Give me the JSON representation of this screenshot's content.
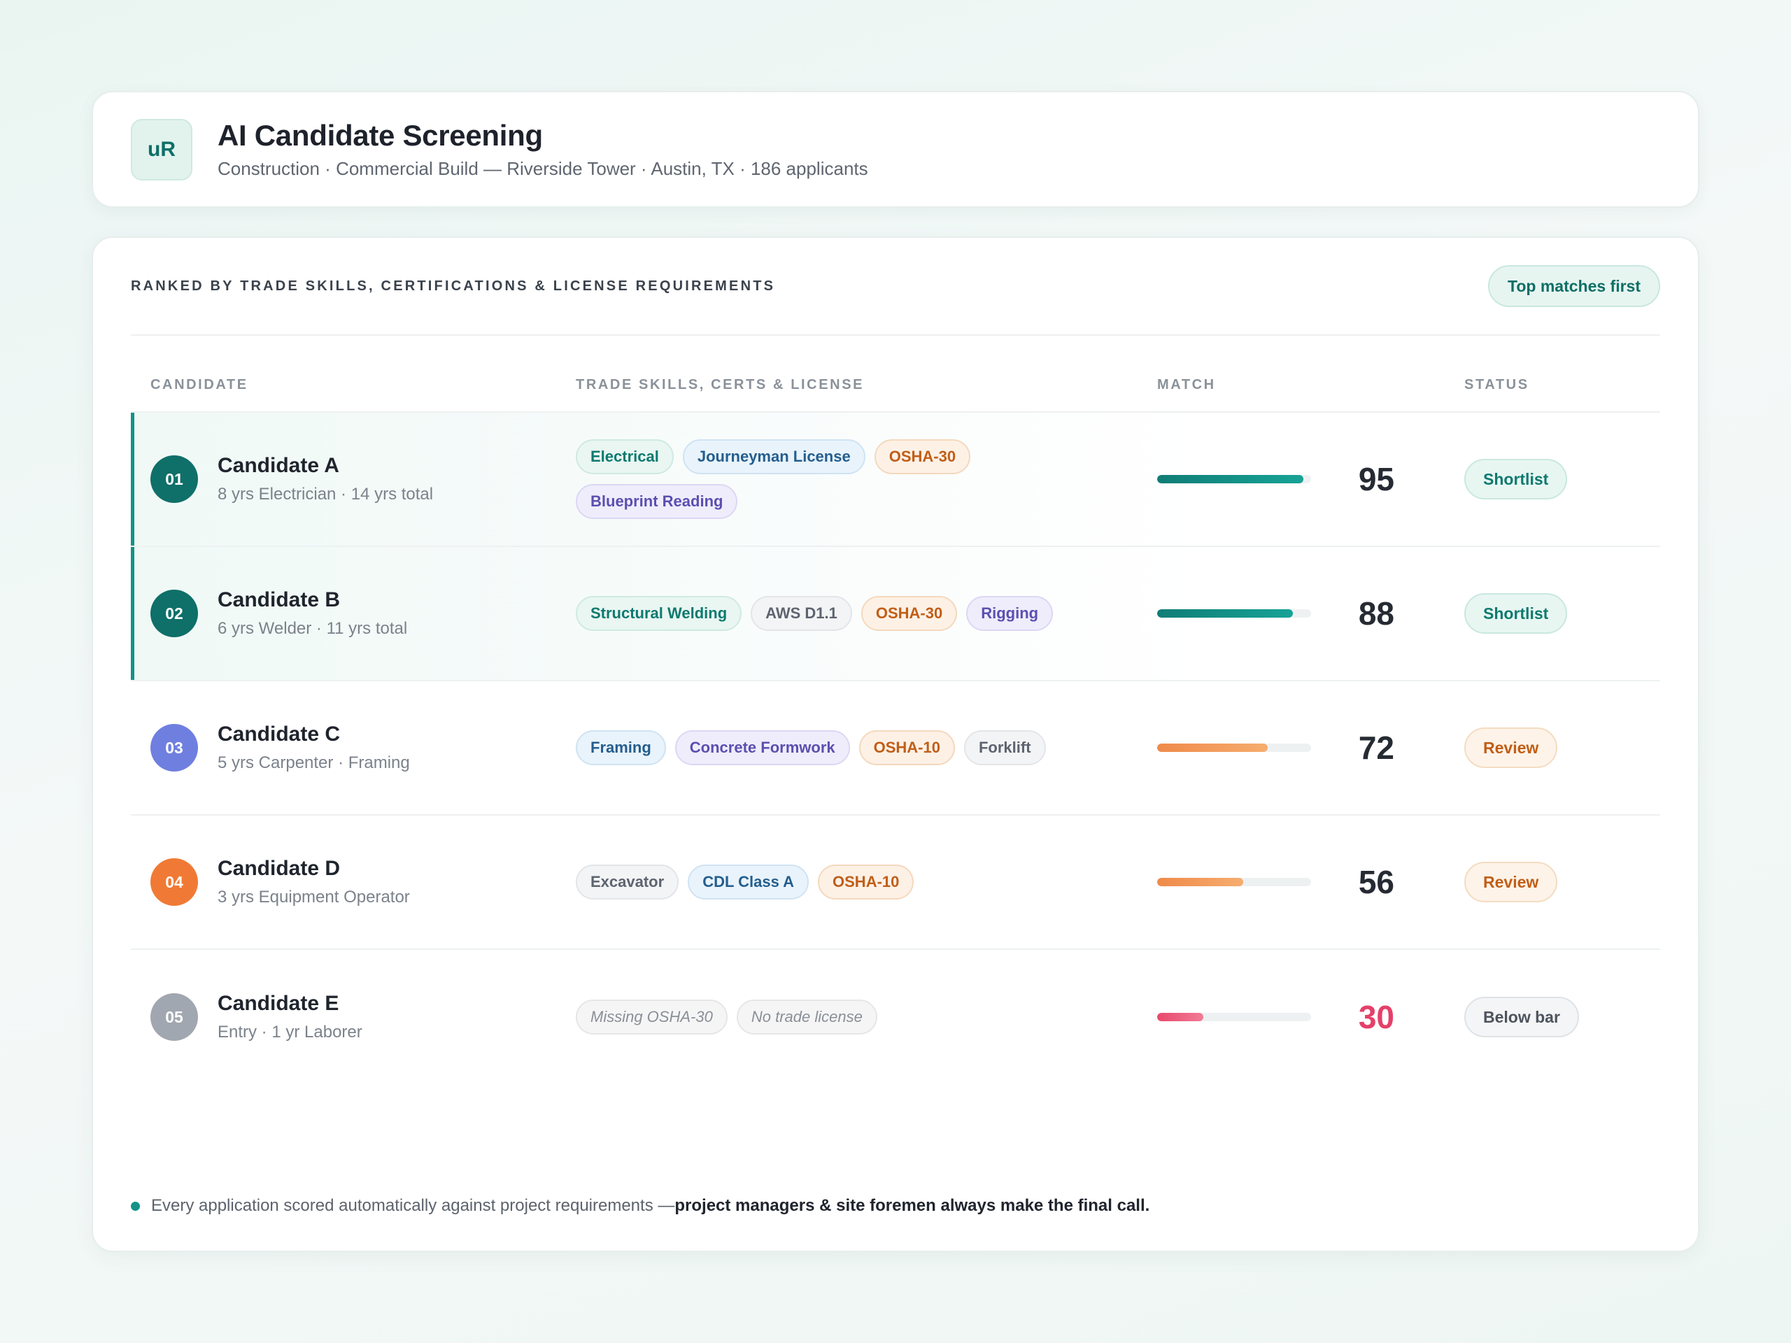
{
  "header": {
    "logo_text": "uR",
    "title": "AI Candidate Screening",
    "subtitle": "Construction · Commercial Build — Riverside Tower · Austin, TX · 186 applicants"
  },
  "panel": {
    "section_title": "RANKED BY TRADE SKILLS, CERTIFICATIONS & LICENSE REQUIREMENTS",
    "sort_label": "Top matches first"
  },
  "columns": {
    "candidate": "CANDIDATE",
    "skills": "TRADE SKILLS, CERTS & LICENSE",
    "match": "MATCH",
    "status": "STATUS"
  },
  "candidates": [
    {
      "rank": "01",
      "name": "Candidate A",
      "meta": "8 yrs Electrician · 14 yrs total",
      "rank_color": "#0f6f69",
      "tags": [
        {
          "label": "Electrical",
          "style": "teal"
        },
        {
          "label": "Journeyman License",
          "style": "blue"
        },
        {
          "label": "OSHA-30",
          "style": "orange"
        },
        {
          "label": "Blueprint Reading",
          "style": "purple"
        }
      ],
      "match": 95,
      "bar_style": "teal",
      "status": "Shortlist",
      "status_style": "shortlist",
      "highlight": true
    },
    {
      "rank": "02",
      "name": "Candidate B",
      "meta": "6 yrs Welder · 11 yrs total",
      "rank_color": "#0f6f69",
      "tags": [
        {
          "label": "Structural Welding",
          "style": "teal"
        },
        {
          "label": "AWS D1.1",
          "style": "gray"
        },
        {
          "label": "OSHA-30",
          "style": "orange"
        },
        {
          "label": "Rigging",
          "style": "purple"
        }
      ],
      "match": 88,
      "bar_style": "teal",
      "status": "Shortlist",
      "status_style": "shortlist",
      "highlight": true
    },
    {
      "rank": "03",
      "name": "Candidate C",
      "meta": "5 yrs Carpenter · Framing",
      "rank_color": "#6f7fe0",
      "tags": [
        {
          "label": "Framing",
          "style": "blue"
        },
        {
          "label": "Concrete Formwork",
          "style": "purple"
        },
        {
          "label": "OSHA-10",
          "style": "orange"
        },
        {
          "label": "Forklift",
          "style": "gray"
        }
      ],
      "match": 72,
      "bar_style": "orange",
      "status": "Review",
      "status_style": "review",
      "highlight": false
    },
    {
      "rank": "04",
      "name": "Candidate D",
      "meta": "3 yrs Equipment Operator",
      "rank_color": "#f07a35",
      "tags": [
        {
          "label": "Excavator",
          "style": "gray"
        },
        {
          "label": "CDL Class A",
          "style": "blue"
        },
        {
          "label": "OSHA-10",
          "style": "orange"
        }
      ],
      "match": 56,
      "bar_style": "orange",
      "status": "Review",
      "status_style": "review",
      "highlight": false
    },
    {
      "rank": "05",
      "name": "Candidate E",
      "meta": "Entry · 1 yr Laborer",
      "rank_color": "#a1a7b0",
      "tags": [
        {
          "label": "Missing OSHA-30",
          "style": "missing"
        },
        {
          "label": "No trade license",
          "style": "missing"
        }
      ],
      "match": 30,
      "bar_style": "pink",
      "status": "Below bar",
      "status_style": "below",
      "highlight": false,
      "low_score": true
    }
  ],
  "footnote": {
    "text": "Every application scored automatically against project requirements — ",
    "emphasis": "project managers & site foremen always make the final call."
  }
}
